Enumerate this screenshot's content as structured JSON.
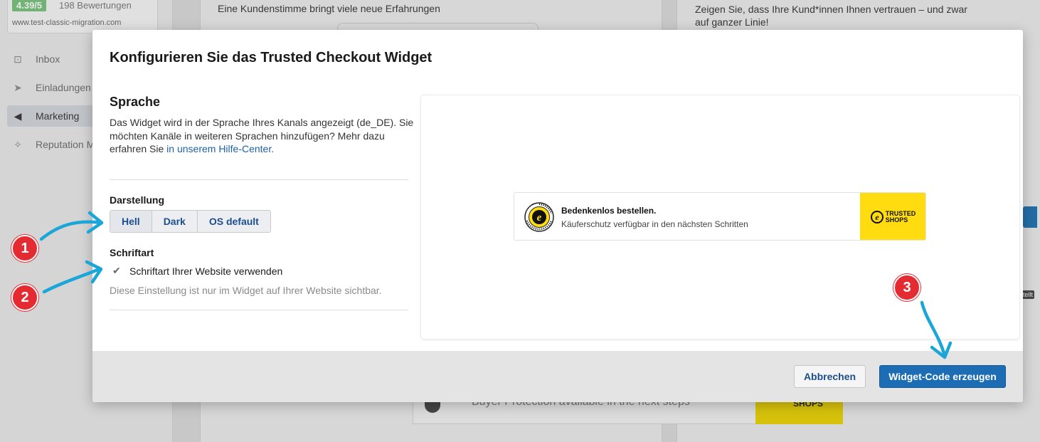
{
  "sidebar": {
    "rating": {
      "score": "4.39/5",
      "count": "198 Bewertungen",
      "url": "www.test-classic-migration.com"
    },
    "items": [
      {
        "label": "Inbox",
        "icon": "inbox-icon",
        "glyph": "⊡"
      },
      {
        "label": "Einladungen",
        "icon": "send-icon",
        "glyph": "➤"
      },
      {
        "label": "Marketing",
        "icon": "megaphone-icon",
        "glyph": "◀"
      },
      {
        "label": "Reputation M",
        "icon": "sparkle-icon",
        "glyph": "✧"
      }
    ]
  },
  "background": {
    "card1_text": "Eine Kundenstimme bringt viele neue Erfahrungen",
    "card2_text": "Zeigen Sie, dass Ihre Kund*innen Ihnen vertrauen – und zwar auf ganzer Linie!",
    "bottom_widget_text": "Buyer Protection available in the next steps",
    "bottom_widget_logo": "SHOPS",
    "right_tag": "tellt"
  },
  "modal": {
    "title": "Konfigurieren Sie das Trusted Checkout Widget",
    "language": {
      "heading": "Sprache",
      "description": "Das Widget wird in der Sprache Ihres Kanals angezeigt (de_DE). Sie möchten Kanäle in weiteren Sprachen hinzufügen? Mehr dazu erfahren Sie ",
      "link_text": "in unserem Hilfe-Center."
    },
    "appearance": {
      "label": "Darstellung",
      "options": [
        "Hell",
        "Dark",
        "OS default"
      ],
      "selected": "Hell"
    },
    "font": {
      "label": "Schriftart",
      "checkbox_label": "Schriftart Ihrer Website verwenden",
      "checked": true,
      "hint": "Diese Einstellung ist nur im Widget auf Ihrer Website sichtbar."
    },
    "preview": {
      "headline": "Bedenkenlos bestellen.",
      "subline": "Käuferschutz verfügbar in den nächsten Schritten",
      "logo_line1": "TRUSTED",
      "logo_line2": "SHOPS",
      "seal_text": "TRUSTED SHOPS GUARANTEE"
    },
    "footer": {
      "cancel_label": "Abbrechen",
      "primary_label": "Widget-Code erzeugen"
    }
  },
  "annotations": {
    "markers": [
      "1",
      "2",
      "3"
    ],
    "marker_color": "#e52b32",
    "arrow_color": "#1aa6d8"
  },
  "colors": {
    "primary": "#1c6db3",
    "link": "#1c62a5",
    "ts_yellow": "#ffdc0f",
    "rating_green": "#4caf50"
  }
}
